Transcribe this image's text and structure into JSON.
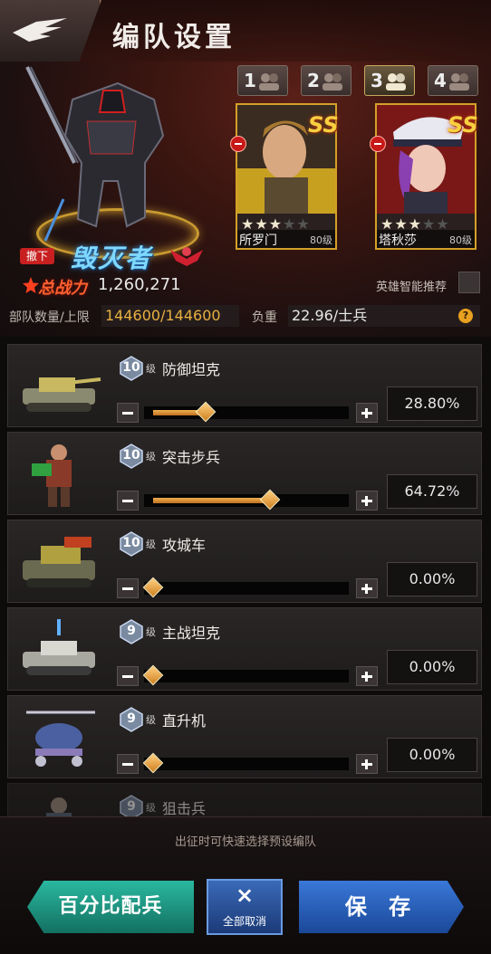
{
  "header": {
    "title": "编队设置"
  },
  "formation_slots": [
    {
      "number": "1"
    },
    {
      "number": "2"
    },
    {
      "number": "3"
    },
    {
      "number": "4"
    }
  ],
  "heroes": [
    {
      "name": "所罗门",
      "level": "80级",
      "grade": "SS",
      "stars": 3,
      "max_stars": 5
    },
    {
      "name": "塔秋莎",
      "level": "80级",
      "grade": "SS",
      "stars": 3,
      "max_stars": 5
    }
  ],
  "mech": {
    "remove_label": "撤下",
    "name": "毁灭者",
    "power_label": "总战力",
    "power_value": "1,260,271"
  },
  "recommend": {
    "label": "英雄智能推荐"
  },
  "stats": {
    "troops_label": "部队数量/上限",
    "troops_value": "144600/144600",
    "load_label": "负重",
    "load_value": "22.96/士兵",
    "help_icon": "?"
  },
  "units": [
    {
      "level": "10",
      "level_suffix": "级",
      "name": "防御坦克",
      "percent": "28.80%",
      "ratio": 0.288
    },
    {
      "level": "10",
      "level_suffix": "级",
      "name": "突击步兵",
      "percent": "64.72%",
      "ratio": 0.6472
    },
    {
      "level": "10",
      "level_suffix": "级",
      "name": "攻城车",
      "percent": "0.00%",
      "ratio": 0.0
    },
    {
      "level": "9",
      "level_suffix": "级",
      "name": "主战坦克",
      "percent": "0.00%",
      "ratio": 0.0
    },
    {
      "level": "9",
      "level_suffix": "级",
      "name": "直升机",
      "percent": "0.00%",
      "ratio": 0.0
    },
    {
      "level": "9",
      "level_suffix": "级",
      "name": "狙击兵",
      "percent": "",
      "ratio": 0.0
    }
  ],
  "footer": {
    "hint": "出征时可快速选择预设编队",
    "ratio_button": "百分比配兵",
    "cancel_all_icon": "×",
    "cancel_all_label": "全部取消",
    "save_button": "保 存"
  },
  "colors": {
    "accent_gold": "#d4a028",
    "slider_orange": "#e0a040",
    "teal_button": "#2ab8a0",
    "blue_button": "#3a78d8",
    "power_red": "#ff6030",
    "mech_name_blue": "#7fd8ff"
  }
}
